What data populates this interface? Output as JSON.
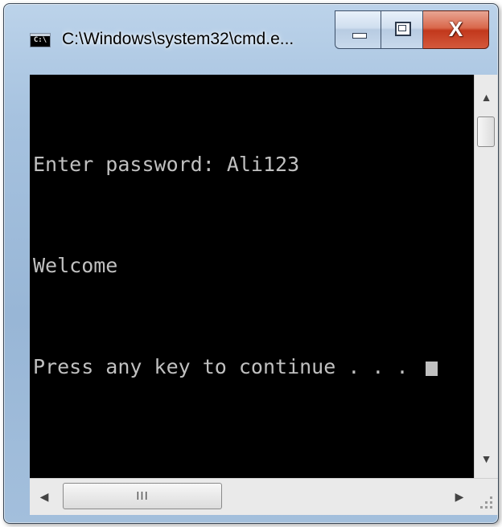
{
  "window": {
    "title": "C:\\Windows\\system32\\cmd.e...",
    "app_icon_label": "C:\\",
    "icons": {
      "app": "cmd-app-icon",
      "minimize": "minimize-icon",
      "maximize": "maximize-icon",
      "close": "close-icon"
    },
    "close_label": "X"
  },
  "console": {
    "lines": [
      "Enter password: Ali123",
      "Welcome",
      "Press any key to continue . . . "
    ],
    "text_color": "#c0c0c0",
    "background": "#000000"
  },
  "scrollbars": {
    "up_arrow": "▲",
    "down_arrow": "▼",
    "left_arrow": "◀",
    "right_arrow": "▶",
    "hthumb_grip": "III"
  },
  "colors": {
    "frame": "#a6c2df",
    "close_button": "#c2381c"
  }
}
